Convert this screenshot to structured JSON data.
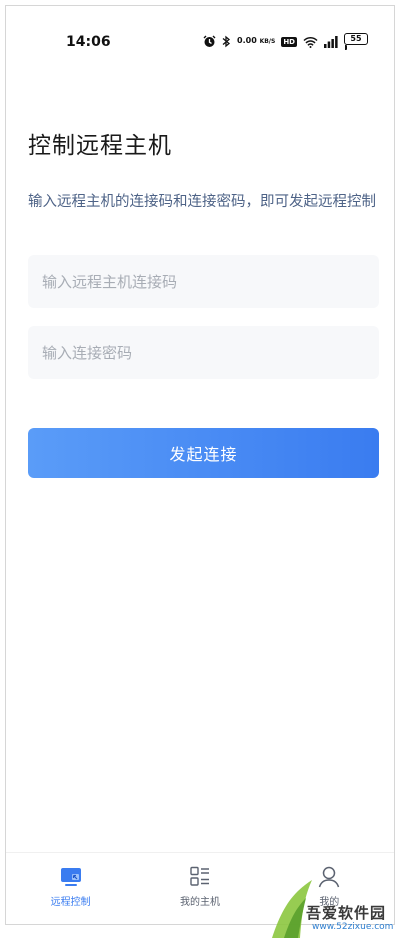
{
  "status_bar": {
    "time": "14:06",
    "net_speed_value": "0.00",
    "net_speed_unit": "KB/S",
    "hd_label": "HD",
    "battery": "55"
  },
  "page": {
    "title": "控制远程主机",
    "hint": "输入远程主机的连接码和连接密码，即可发起远程控制"
  },
  "form": {
    "code_placeholder": "输入远程主机连接码",
    "password_placeholder": "输入连接密码",
    "connect_label": "发起连接"
  },
  "tabs": [
    {
      "label": "远程控制",
      "icon": "monitor-icon",
      "active": true
    },
    {
      "label": "我的主机",
      "icon": "host-list-icon",
      "active": false
    },
    {
      "label": "我的",
      "icon": "user-icon",
      "active": false
    }
  ],
  "watermark": {
    "text": "吾爱软件园",
    "url": "www.52zixue.com"
  },
  "colors": {
    "accent": "#3a7cf0",
    "hint_text": "#4e6387",
    "field_bg": "#f7f8fa"
  }
}
